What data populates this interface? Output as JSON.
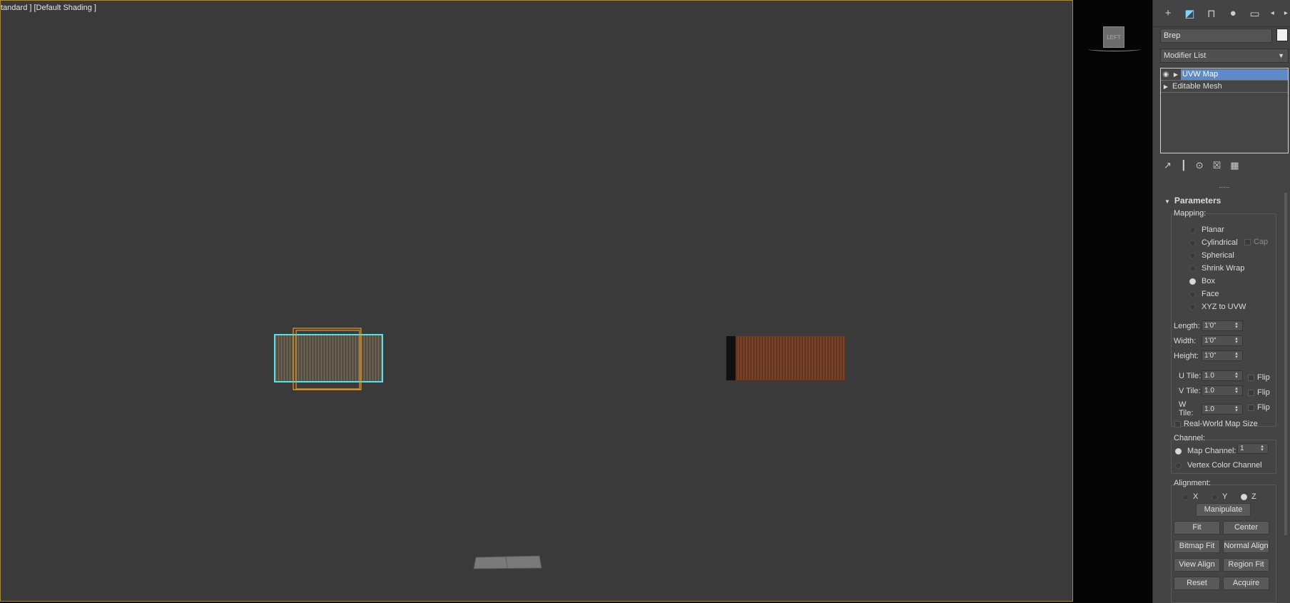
{
  "viewport": {
    "label": "tandard ] [Default Shading ]",
    "cube_label": "LEFT"
  },
  "panel": {
    "object_name": "Brep",
    "modifier_list_label": "Modifier List",
    "stack": [
      {
        "label": "UVW Map",
        "selected": true
      },
      {
        "label": "Editable Mesh",
        "selected": false
      }
    ],
    "rollout_title": "Parameters",
    "mapping": {
      "label": "Mapping:",
      "options": [
        "Planar",
        "Cylindrical",
        "Spherical",
        "Shrink Wrap",
        "Box",
        "Face",
        "XYZ to UVW"
      ],
      "selected": "Box",
      "cap_label": "Cap"
    },
    "dims": {
      "length_label": "Length:",
      "length": "1'0\"",
      "width_label": "Width:",
      "width": "1'0\"",
      "height_label": "Height:",
      "height": "1'0\""
    },
    "tiles": {
      "u_label": "U Tile:",
      "u": "1.0",
      "v_label": "V Tile:",
      "v": "1.0",
      "w_label": "W Tile:",
      "w": "1.0",
      "flip_label": "Flip"
    },
    "real_world_label": "Real-World Map Size",
    "channel": {
      "label": "Channel:",
      "map_channel_label": "Map Channel:",
      "map_channel_value": "1",
      "vertex_color_label": "Vertex Color Channel"
    },
    "alignment": {
      "label": "Alignment:",
      "x": "X",
      "y": "Y",
      "z": "Z",
      "manipulate": "Manipulate",
      "fit": "Fit",
      "center": "Center",
      "bitmap_fit": "Bitmap Fit",
      "normal_align": "Normal Align",
      "view_align": "View Align",
      "region_fit": "Region Fit",
      "reset": "Reset",
      "acquire": "Acquire"
    }
  },
  "colors": {
    "selection_cyan": "#4fe3ee",
    "gizmo_orange": "#e39a2a",
    "viewport_border": "#a38d33",
    "stack_selected": "#5d8acb"
  }
}
